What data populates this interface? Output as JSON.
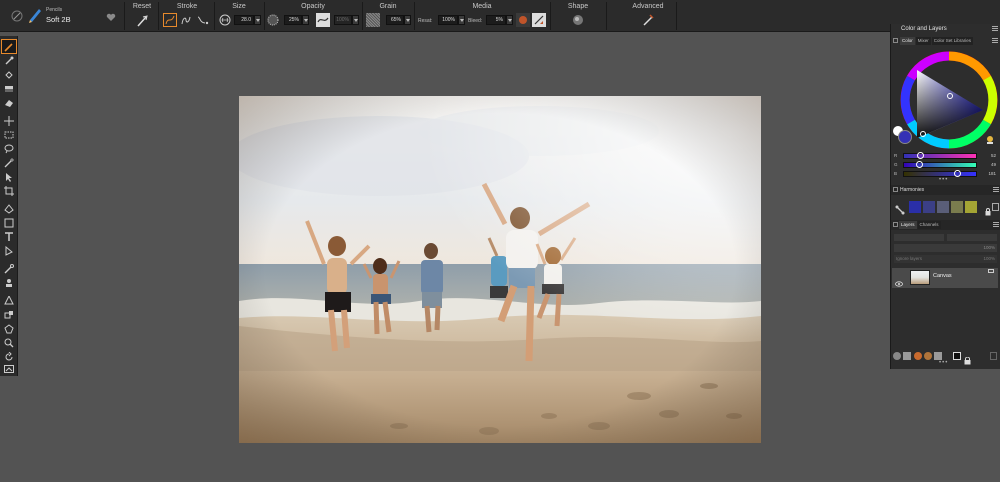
{
  "brush": {
    "category": "Pencils",
    "variant": "Soft 2B"
  },
  "toolbar": {
    "reset_label": "Reset",
    "stroke_label": "Stroke",
    "size_label": "Size",
    "size_value": "28.0",
    "opacity_label": "Opacity",
    "opacity_value": "25%",
    "opacity_value2": "100%",
    "grain_label": "Grain",
    "grain_value": "65%",
    "media_label": "Media",
    "resat_label": "Resat:",
    "resat_value": "100%",
    "bleed_label": "Bleed:",
    "bleed_value": "5%",
    "shape_label": "Shape",
    "advanced_label": "Advanced"
  },
  "panel": {
    "title": "Color and Layers",
    "color_tabs": [
      "Color",
      "Mixer",
      "Color Set Libraries"
    ],
    "rgb": [
      {
        "label": "R",
        "value": "52",
        "level": 0.2
      },
      {
        "label": "G",
        "value": "49",
        "level": 0.19
      },
      {
        "label": "B",
        "value": "181",
        "level": 0.71
      }
    ],
    "harmonies_label": "Harmonies",
    "harmony_colors": [
      "#2a2fa8",
      "#3b3f86",
      "#5a5e78",
      "#7a7c4e",
      "#a4a534"
    ],
    "layer_tabs": [
      "Layers",
      "Channels"
    ],
    "layer_opacity": "100%",
    "ignore_layers": "Ignore layers",
    "ignore_value": "100%",
    "canvas_layer": "Canvas"
  },
  "colors": {
    "accent": "#e88a2c",
    "current_color": "#3431b5",
    "app_bg": "#535353",
    "bar_bg": "#2b2b2b"
  }
}
